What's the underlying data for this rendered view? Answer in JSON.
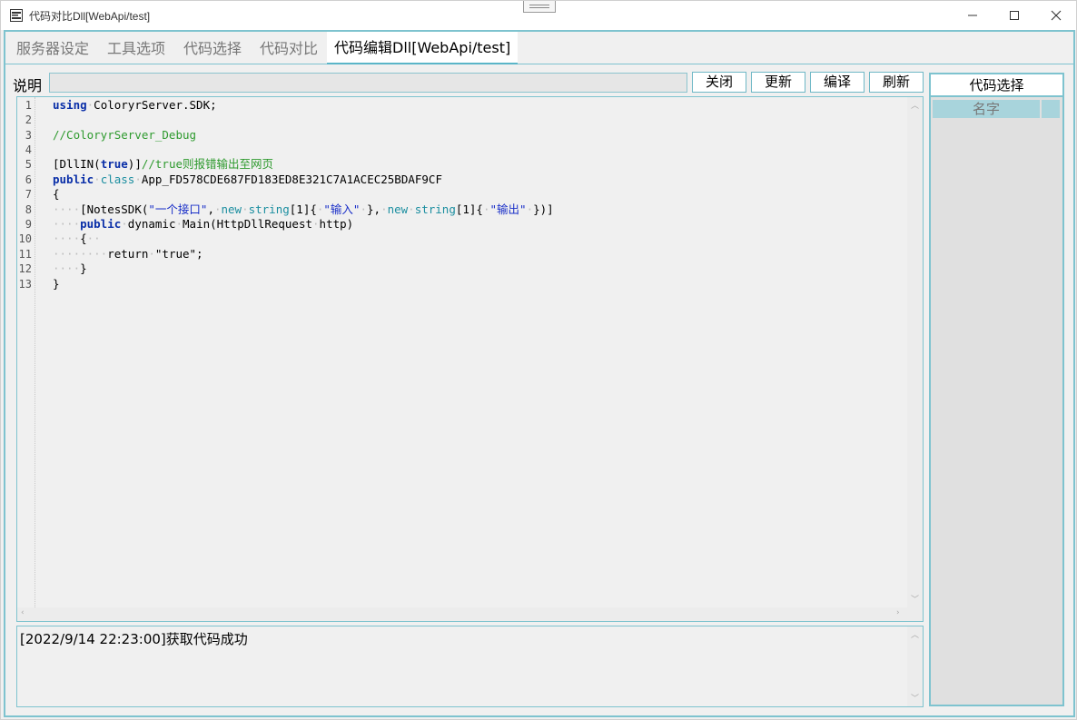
{
  "window": {
    "title": "代码对比Dll[WebApi/test]"
  },
  "tabs": [
    {
      "label": "服务器设定"
    },
    {
      "label": "工具选项"
    },
    {
      "label": "代码选择"
    },
    {
      "label": "代码对比"
    },
    {
      "label": "代码编辑Dll[WebApi/test]"
    }
  ],
  "description": {
    "label": "说明",
    "value": ""
  },
  "buttons": {
    "close": "关闭",
    "update": "更新",
    "compile": "编译",
    "refresh": "刷新"
  },
  "editor": {
    "line_numbers": [
      "1",
      "2",
      "3",
      "4",
      "5",
      "6",
      "7",
      "8",
      "9",
      "10",
      "11",
      "12",
      "13"
    ]
  },
  "log": {
    "text": "[2022/9/14 22:23:00]获取代码成功"
  },
  "right_panel": {
    "title": "代码选择",
    "column_header": "名字"
  },
  "colors": {
    "accent": "#7ec3cf",
    "keyword": "#0a2fa8",
    "comment": "#2e9a2e",
    "string": "#1a2fc8"
  }
}
